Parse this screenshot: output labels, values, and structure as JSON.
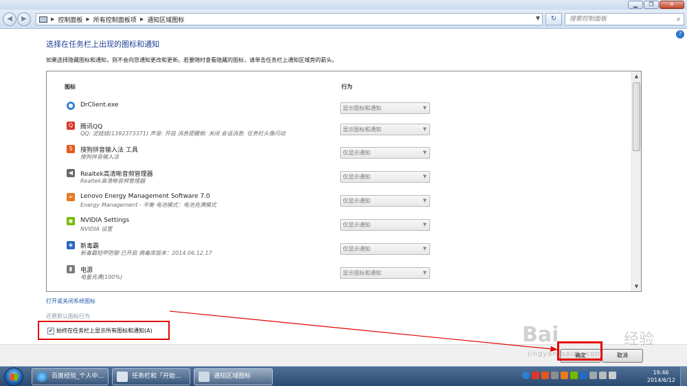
{
  "window": {
    "buttons": {
      "minimize": "▁",
      "maximize": "❐",
      "close": "✕"
    }
  },
  "nav": {
    "back": "◀",
    "forward": "▶",
    "breadcrumb": [
      "控制面板",
      "所有控制面板项",
      "通知区域图标"
    ],
    "refresh": "↻",
    "search_placeholder": "搜索控制面板",
    "search_icon": "⌕"
  },
  "help": "?",
  "page": {
    "heading": "选择在任务栏上出现的图标和通知",
    "description": "如果选择隐藏图标和通知，则不会向您通知更改和更新。若要随时查看隐藏的图标，请单击任务栏上通知区域旁的箭头。",
    "columns": {
      "icon": "图标",
      "behavior": "行为"
    },
    "rows": [
      {
        "icon": "globe-icon",
        "icon_color": "#2f7fce",
        "glyph": "●",
        "name": "DrClient.exe",
        "sub": "",
        "behavior": "显示图标和通知"
      },
      {
        "icon": "qq-penguin-icon",
        "icon_color": "#d9382b",
        "glyph": "Q",
        "name": "腾讯QQ",
        "sub": "QQ: 泥娃娃(1392373371)  声音: 开启  消息提醒框: 关闭  会话消息: 任务栏头像闪动",
        "behavior": "显示图标和通知"
      },
      {
        "icon": "sogou-icon",
        "icon_color": "#e8561c",
        "glyph": "S",
        "name": "搜狗拼音输入法 工具",
        "sub": "搜狗拼音输入法",
        "behavior": "仅显示通知"
      },
      {
        "icon": "speaker-icon",
        "icon_color": "#6b6b6b",
        "glyph": "◀",
        "name": "Realtek高清晰音频管理器",
        "sub": "Realtek高清晰音频管理器",
        "behavior": "仅显示通知"
      },
      {
        "icon": "lenovo-energy-icon",
        "icon_color": "#e57a1f",
        "glyph": "∞",
        "name": "Lenovo Energy Management Software 7.0",
        "sub": "Energy Management - 平衡 电池模式：电池充满模式",
        "behavior": "仅显示通知"
      },
      {
        "icon": "nvidia-icon",
        "icon_color": "#76b900",
        "glyph": "◉",
        "name": "NVIDIA Settings",
        "sub": "NVIDIA 设置",
        "behavior": "仅显示通知"
      },
      {
        "icon": "antivirus-shield-icon",
        "icon_color": "#2769c2",
        "glyph": "◈",
        "name": "新毒霸",
        "sub": "新毒霸铠甲防御 已开启 病毒库版本：2014.06.12.17",
        "behavior": "仅显示通知"
      },
      {
        "icon": "power-icon",
        "icon_color": "#7a7a7a",
        "glyph": "▮",
        "name": "电源",
        "sub": "电量充满(100%)",
        "behavior": "显示图标和通知"
      }
    ],
    "link_system_icons": "打开或关闭系统图标",
    "link_restore": "还原默认图标行为",
    "always_show_label": "始终在任务栏上显示所有图标和通知(A)",
    "always_show_checked": "✔"
  },
  "buttons": {
    "ok": "确定",
    "cancel": "取消"
  },
  "watermark": {
    "text": "Bai",
    "suffix": "经验",
    "url": "jingyan.baidu.com"
  },
  "taskbar": {
    "items": [
      {
        "label": "百度经验_个人中...",
        "icon": "ie-icon"
      },
      {
        "label": "任务栏和「开始...",
        "icon": "taskbar-props-icon"
      },
      {
        "label": "通知区域图标",
        "icon": "notification-icons-icon"
      }
    ],
    "time": "19:46",
    "date": "2014/6/12"
  },
  "colors": {
    "accent_red": "#e30000",
    "heading_blue": "#1e3e95",
    "link_blue": "#1f5aa6"
  }
}
